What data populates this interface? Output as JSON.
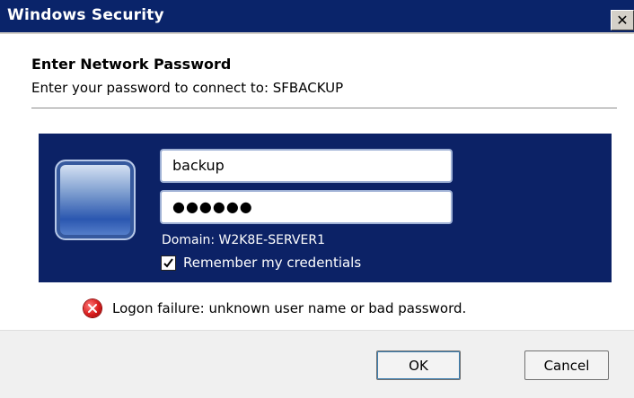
{
  "window": {
    "title": "Windows Security",
    "close_label": "✕"
  },
  "dialog": {
    "heading": "Enter Network Password",
    "subheading": "Enter your password to connect to: SFBACKUP"
  },
  "credentials": {
    "username_value": "backup",
    "password_masked": "●●●●●●",
    "domain_text": "Domain: W2K8E-SERVER1",
    "remember_label": "Remember my credentials",
    "remember_checked": true,
    "avatar_icon": "user-tile-icon"
  },
  "error": {
    "icon": "error-icon",
    "message": "Logon failure: unknown user name or bad password."
  },
  "buttons": {
    "ok_label": "OK",
    "cancel_label": "Cancel"
  },
  "colors": {
    "titlebar": "#0a246a",
    "panel": "#0c2266",
    "error_red": "#d81b1b"
  }
}
